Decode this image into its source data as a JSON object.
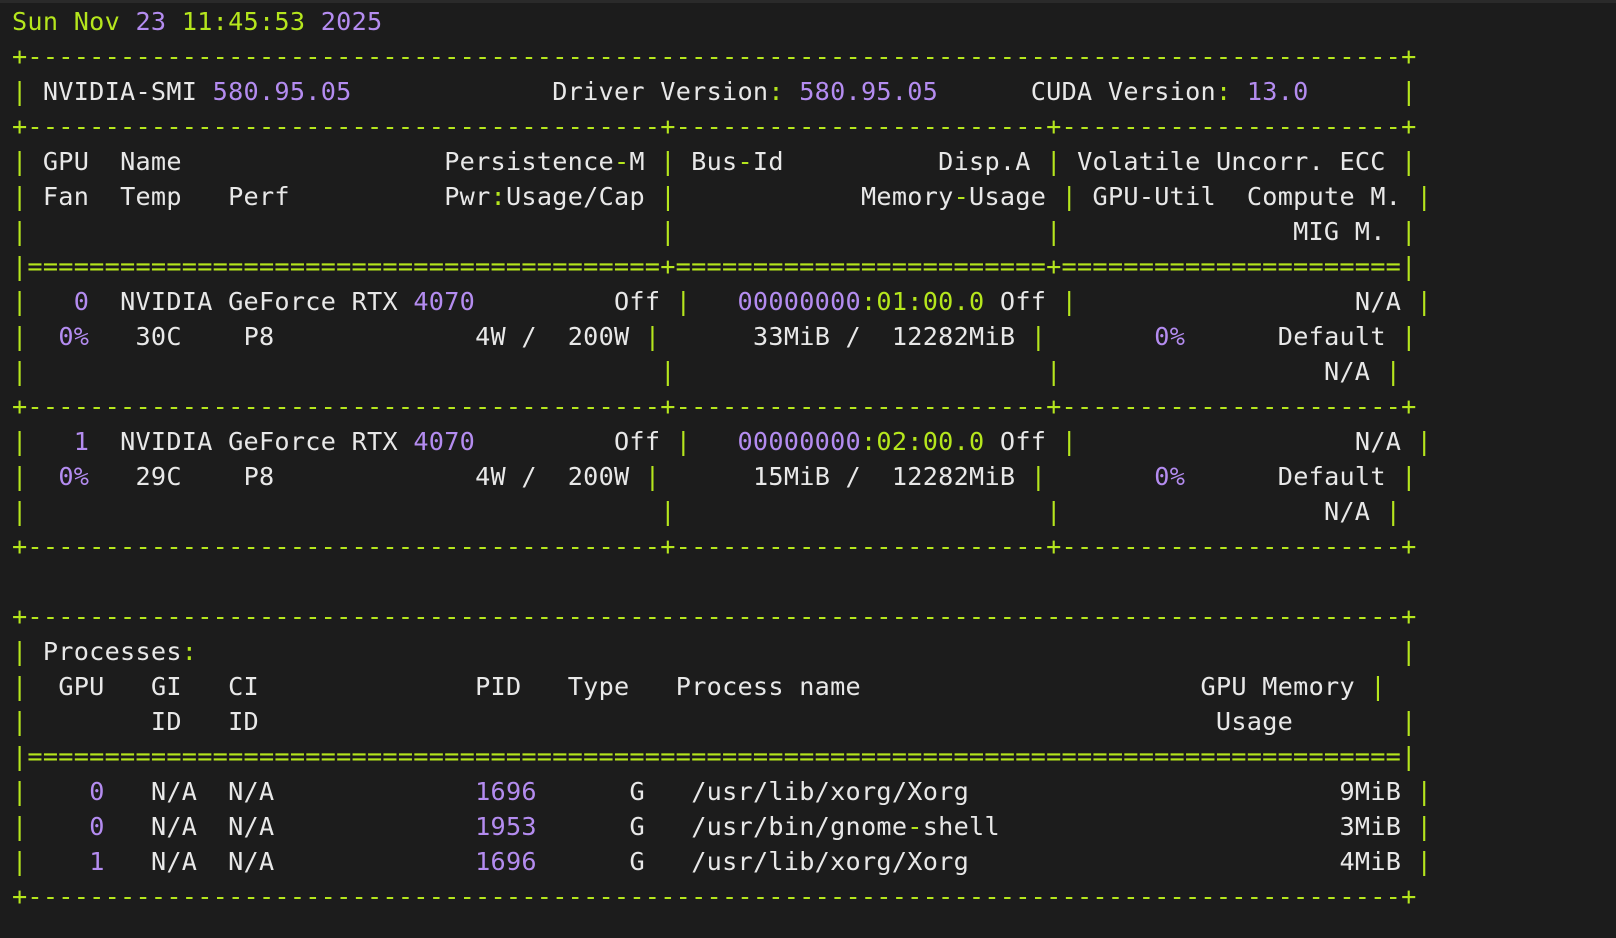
{
  "timestamp": {
    "weekday": "Sun",
    "month": "Nov",
    "day": "23",
    "time": "11:45:53",
    "year": "2025"
  },
  "header": {
    "smi_label": "NVIDIA-SMI",
    "smi_version": "580.95.05",
    "driver_label": "Driver Version",
    "driver_version": "580.95.05",
    "cuda_label": "CUDA Version",
    "cuda_version": "13.0"
  },
  "gpu_table": {
    "headers": {
      "row1": {
        "gpu": "GPU",
        "name": "Name",
        "persistence": "Persistence-M",
        "bus_id": "Bus-Id",
        "disp": "Disp.A",
        "volatile": "Volatile Uncorr. ECC"
      },
      "row2": {
        "fan": "Fan",
        "temp": "Temp",
        "perf": "Perf",
        "power": "Pwr:Usage/Cap",
        "memory": "Memory-Usage",
        "util": "GPU-Util",
        "compute": "Compute M."
      },
      "row3": {
        "mig": "MIG M."
      }
    },
    "gpus": [
      {
        "index": "0",
        "name_prefix": "NVIDIA GeForce RTX",
        "model": "4070",
        "persistence": "Off",
        "bus_prefix": "00000000",
        "bus_rest": "01:00.0",
        "disp": "Off",
        "ecc": "N/A",
        "fan": "0%",
        "temp": "30C",
        "perf": "P8",
        "power_usage": "4W",
        "power_cap": "200W",
        "mem_used": "33MiB",
        "mem_total": "12282MiB",
        "util": "0%",
        "compute_mode": "Default",
        "mig_mode": "N/A"
      },
      {
        "index": "1",
        "name_prefix": "NVIDIA GeForce RTX",
        "model": "4070",
        "persistence": "Off",
        "bus_prefix": "00000000",
        "bus_rest": "02:00.0",
        "disp": "Off",
        "ecc": "N/A",
        "fan": "0%",
        "temp": "29C",
        "perf": "P8",
        "power_usage": "4W",
        "power_cap": "200W",
        "mem_used": "15MiB",
        "mem_total": "12282MiB",
        "util": "0%",
        "compute_mode": "Default",
        "mig_mode": "N/A"
      }
    ]
  },
  "processes": {
    "title": "Processes",
    "headers": {
      "gpu": "GPU",
      "gi": "GI",
      "ci": "CI",
      "gi_id": "ID",
      "ci_id": "ID",
      "pid": "PID",
      "type": "Type",
      "name": "Process name",
      "memory_1": "GPU Memory",
      "memory_2": "Usage"
    },
    "rows": [
      {
        "gpu": "0",
        "gi": "N/A",
        "ci": "N/A",
        "pid": "1696",
        "type": "G",
        "name": "/usr/lib/xorg/Xorg",
        "memory": "9MiB"
      },
      {
        "gpu": "0",
        "gi": "N/A",
        "ci": "N/A",
        "pid": "1953",
        "type": "G",
        "name": "/usr/bin/gnome-shell",
        "memory": "3MiB"
      },
      {
        "gpu": "1",
        "gi": "N/A",
        "ci": "N/A",
        "pid": "1696",
        "type": "G",
        "name": "/usr/lib/xorg/Xorg",
        "memory": "4MiB"
      }
    ]
  },
  "colors": {
    "background": "#1c1c1c",
    "border_green": "#b5e61d",
    "number_purple": "#b48cf0",
    "text_white": "#e8e8e8"
  }
}
